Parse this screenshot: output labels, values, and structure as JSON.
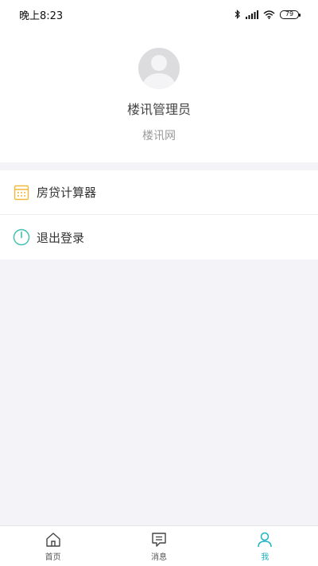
{
  "status_bar": {
    "time": "晚上8:23",
    "battery": "79",
    "icons": [
      "bluetooth-icon",
      "signal-icon",
      "wifi-icon",
      "battery-icon"
    ]
  },
  "profile": {
    "name": "楼讯管理员",
    "site": "楼讯网"
  },
  "menu": {
    "items": [
      {
        "label": "房贷计算器",
        "icon": "calculator-icon",
        "color": "#f0b93a"
      },
      {
        "label": "退出登录",
        "icon": "power-icon",
        "color": "#3cbfae"
      }
    ]
  },
  "tab_bar": {
    "tabs": [
      {
        "label": "首页",
        "icon": "home-icon"
      },
      {
        "label": "消息",
        "icon": "message-icon"
      },
      {
        "label": "我",
        "icon": "user-icon",
        "active": true
      }
    ],
    "active_color": "#1eb2c4"
  }
}
